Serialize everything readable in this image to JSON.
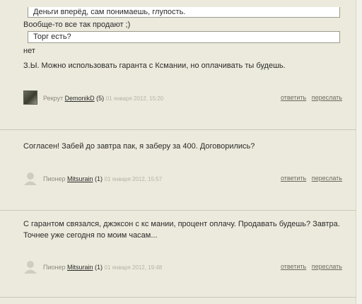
{
  "post1": {
    "quote_top": "Деньги вперёд, сам понимаешь, глупость.",
    "reply_line": "Вообще-то все так продают ;)",
    "quote_bottom": "Торг есть?",
    "answer": "нет",
    "ps": "З.Ы. Можно использовать гаранта с Ксмании, но оплачивать ты будешь.",
    "rank": "Рекрут",
    "user": "DemonikD",
    "rep": "(5)",
    "date": "01 января 2012, 15:20",
    "reply_label": "ответить",
    "forward_label": "переслать"
  },
  "post2": {
    "text": "Согласен! Забей до завтра пак, я заберу за 400. Договорились?",
    "rank": "Пионер",
    "user": "Mitsurain",
    "rep": "(1)",
    "date": "01 января 2012, 15:57",
    "reply_label": "ответить",
    "forward_label": "переслать"
  },
  "post3": {
    "text_line1": "С гарантом связался, джэксон с кс мании, процент оплачу. Продавать будешь? Завтра.",
    "text_line2": "Точнее уже сегодня по моим часам...",
    "rank": "Пионер",
    "user": "Mitsurain",
    "rep": "(1)",
    "date": "01 января 2012, 19:48",
    "reply_label": "ответить",
    "forward_label": "переслать"
  }
}
